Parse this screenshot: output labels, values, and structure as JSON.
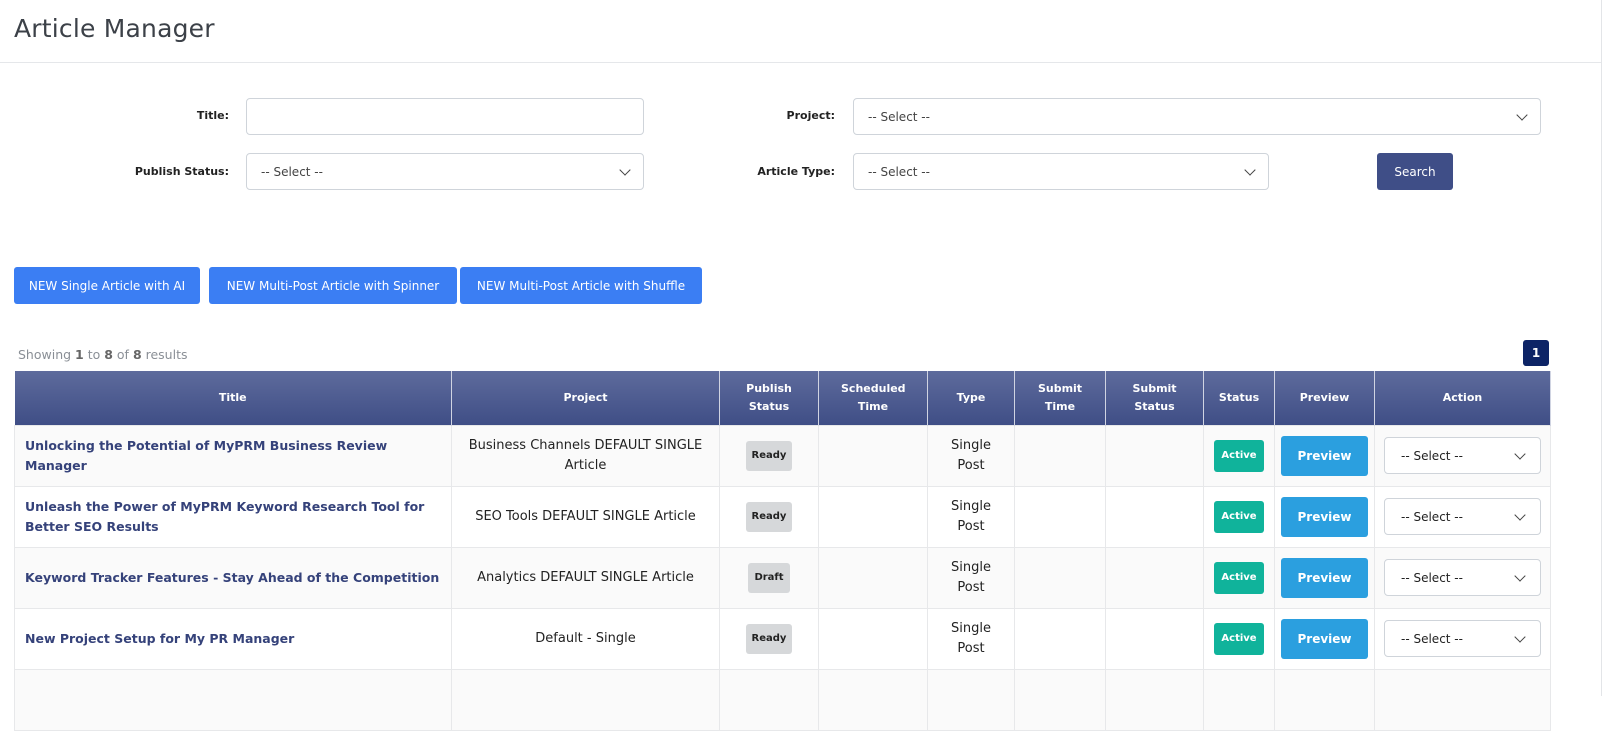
{
  "header": {
    "title": "Article Manager"
  },
  "filters": {
    "title_label": "Title:",
    "title_value": "",
    "project_label": "Project:",
    "project_value": "-- Select --",
    "publish_status_label": "Publish Status:",
    "publish_status_value": "-- Select --",
    "article_type_label": "Article Type:",
    "article_type_value": "-- Select --",
    "search_label": "Search"
  },
  "actions": {
    "new_single_ai": "NEW Single Article with AI",
    "new_multi_spinner": "NEW Multi-Post Article with Spinner",
    "new_multi_shuffle": "NEW Multi-Post Article with Shuffle"
  },
  "results": {
    "showing": "Showing ",
    "from": "1",
    "to_word": " to ",
    "to": "8",
    "of_word": " of ",
    "total": "8",
    "suffix": " results",
    "page": "1"
  },
  "table": {
    "columns": [
      "Title",
      "Project",
      "Publish Status",
      "Scheduled Time",
      "Type",
      "Submit Time",
      "Submit Status",
      "Status",
      "Preview",
      "Action"
    ],
    "rows": [
      {
        "title": "Unlocking the Potential of MyPRM Business Review Manager",
        "project": "Business Channels DEFAULT SINGLE Article",
        "publish_status": "Ready",
        "scheduled_time": "",
        "type": "Single Post",
        "submit_time": "",
        "submit_status": "",
        "status": "Active",
        "preview": "Preview",
        "action": "-- Select --"
      },
      {
        "title": "Unleash the Power of MyPRM Keyword Research Tool for Better SEO Results",
        "project": "SEO Tools DEFAULT SINGLE Article",
        "publish_status": "Ready",
        "scheduled_time": "",
        "type": "Single Post",
        "submit_time": "",
        "submit_status": "",
        "status": "Active",
        "preview": "Preview",
        "action": "-- Select --"
      },
      {
        "title": "Keyword Tracker Features - Stay Ahead of the Competition",
        "project": "Analytics DEFAULT SINGLE Article",
        "publish_status": "Draft",
        "scheduled_time": "",
        "type": "Single Post",
        "submit_time": "",
        "submit_status": "",
        "status": "Active",
        "preview": "Preview",
        "action": "-- Select --"
      },
      {
        "title": "New Project Setup for My PR Manager",
        "project": "Default - Single",
        "publish_status": "Ready",
        "scheduled_time": "",
        "type": "Single Post",
        "submit_time": "",
        "submit_status": "",
        "status": "Active",
        "preview": "Preview",
        "action": "-- Select --"
      }
    ]
  }
}
